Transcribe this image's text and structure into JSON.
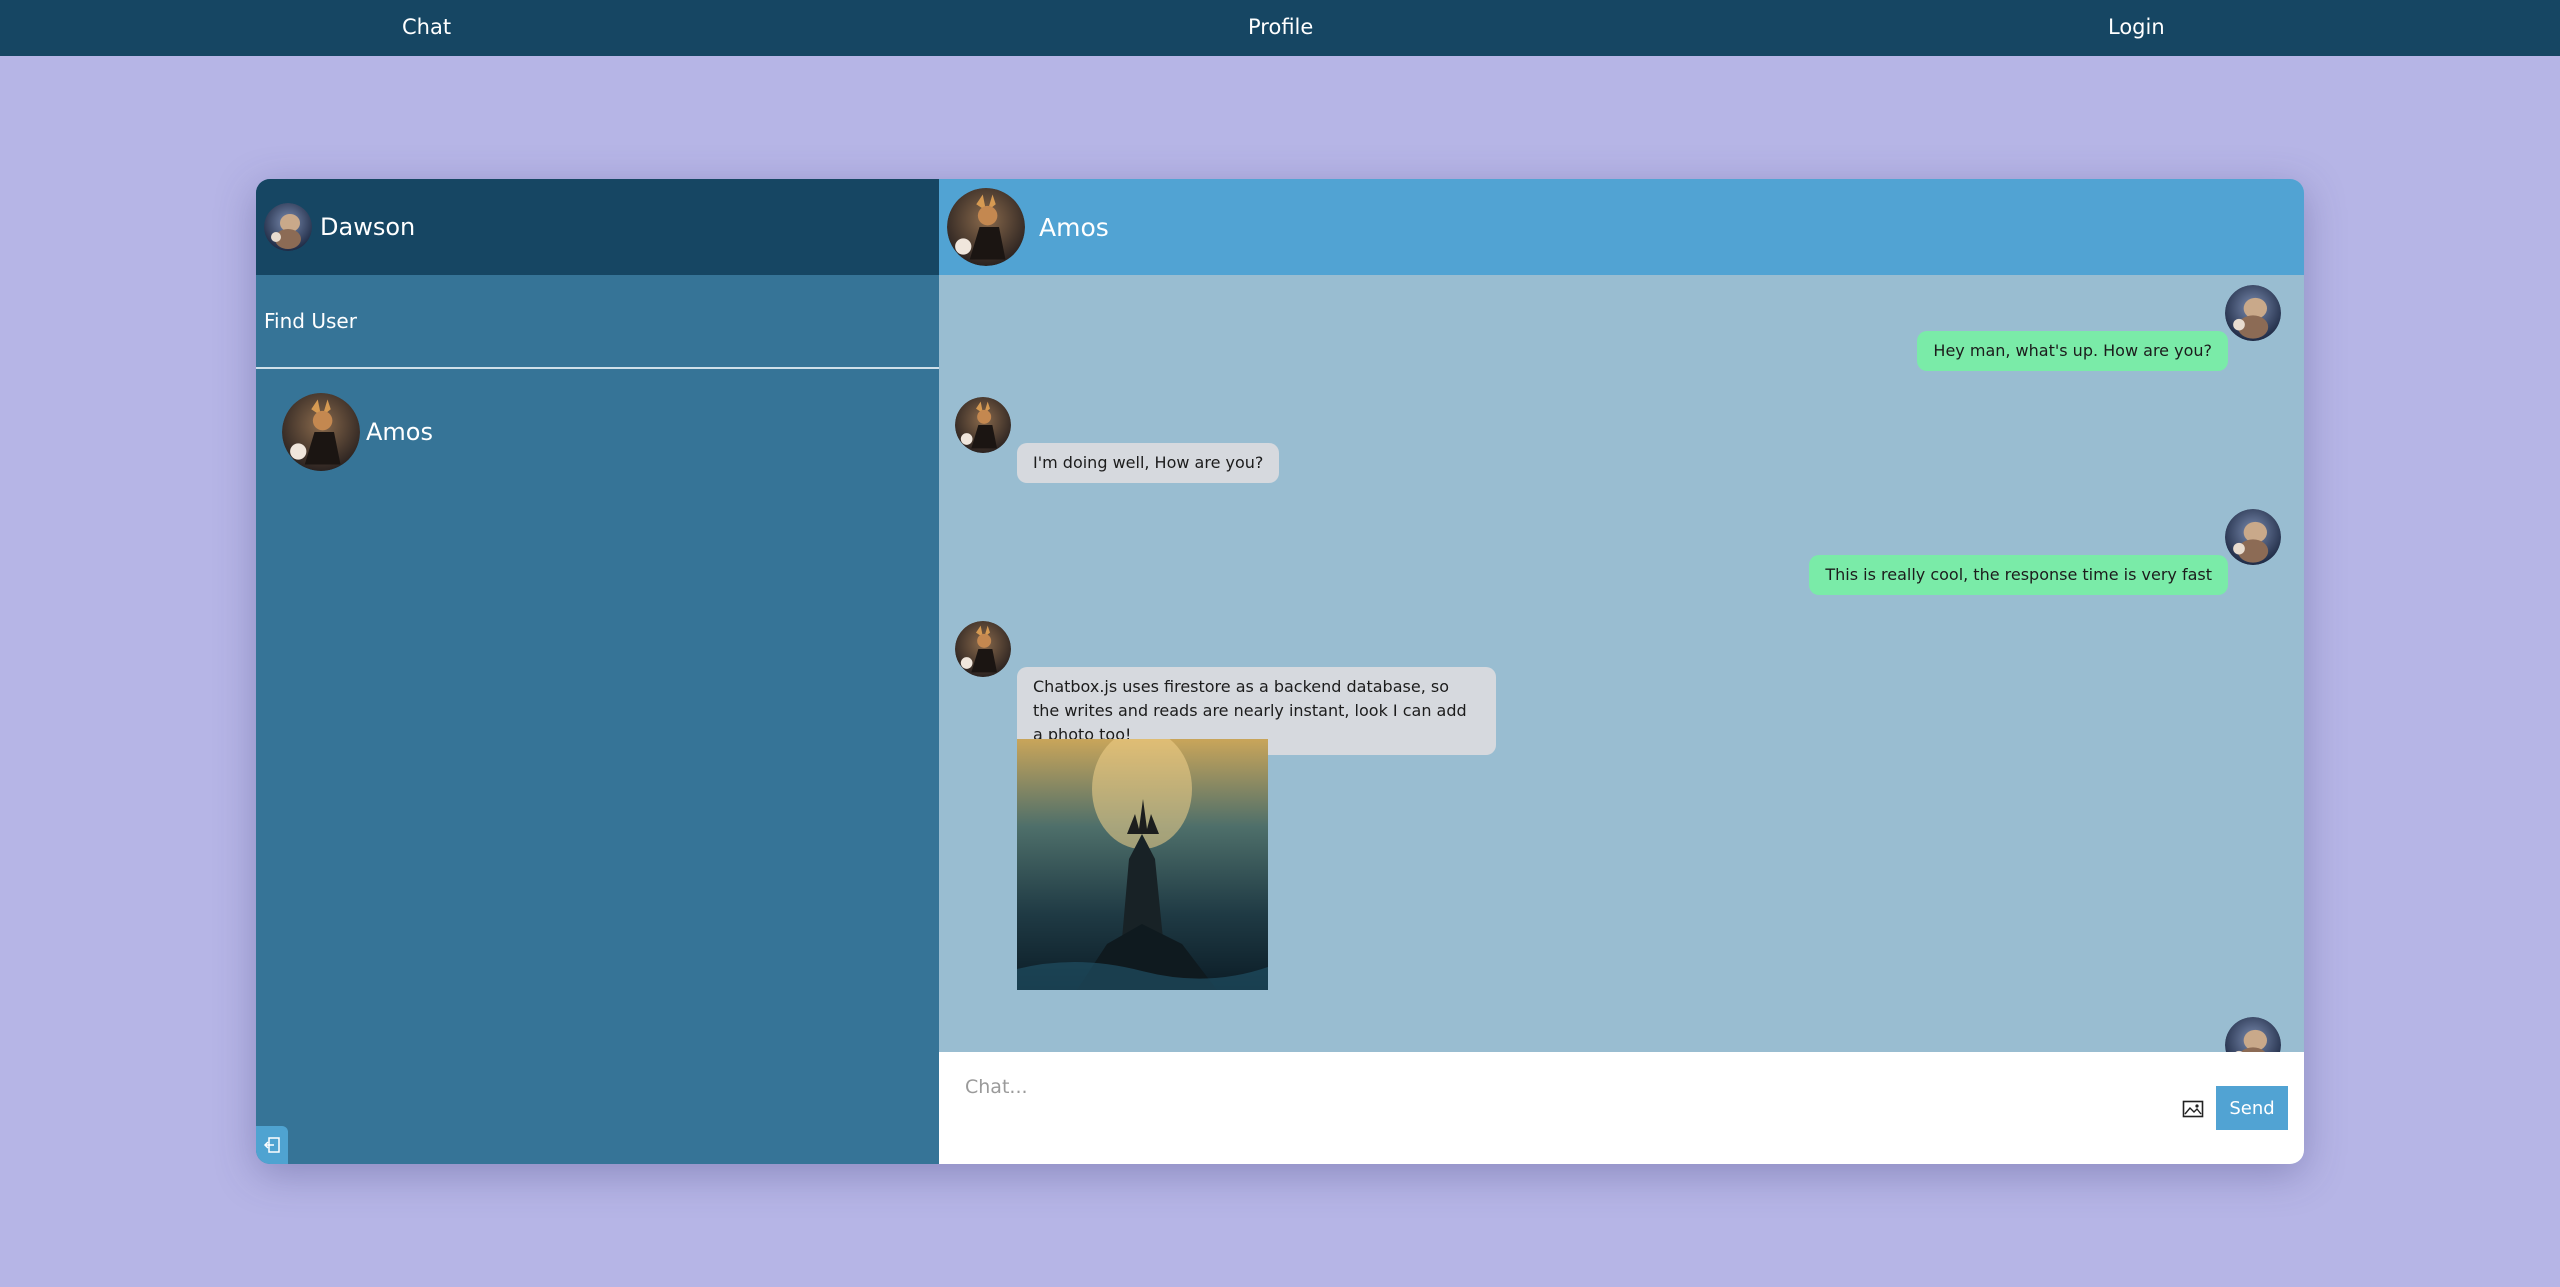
{
  "nav": {
    "chat": "Chat",
    "profile": "Profile",
    "login": "Login"
  },
  "sidebar": {
    "current_user": "Dawson",
    "search_placeholder": "Find User",
    "contacts": [
      {
        "name": "Amos"
      }
    ]
  },
  "chat": {
    "recipient": "Amos",
    "messages": [
      {
        "from": "me",
        "text": "Hey man, what's up. How are you?"
      },
      {
        "from": "them",
        "text": "I'm doing well, How are you?"
      },
      {
        "from": "me",
        "text": "This is really cool, the response time is very fast"
      },
      {
        "from": "them",
        "text": "Chatbox.js uses firestore as a backend database, so the writes and reads are nearly instant, look I can add a photo too!"
      }
    ],
    "input_placeholder": "Chat...",
    "send_label": "Send"
  },
  "colors": {
    "background": "#b6b5e6",
    "nav": "#164663",
    "sidebar": "#367497",
    "chat_header": "#51a3d3",
    "chat_body": "#99bdd1",
    "my_bubble": "#7aeba8",
    "their_bubble": "#d6d9de"
  }
}
